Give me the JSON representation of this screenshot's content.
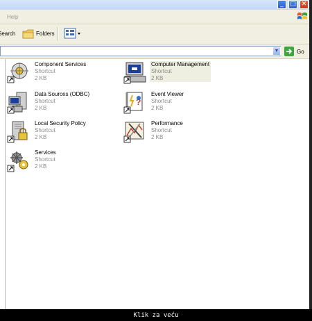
{
  "menubar": {
    "help_label": "Help"
  },
  "toolbar": {
    "search_label": "Search",
    "folders_label": "Folders"
  },
  "address": {
    "value": "",
    "go_label": "Go"
  },
  "items": [
    {
      "name": "Component Services",
      "type": "Shortcut",
      "size": "2 KB",
      "icon": "component-services-icon"
    },
    {
      "name": "Computer Management",
      "type": "Shortcut",
      "size": "2 KB",
      "icon": "computer-management-icon"
    },
    {
      "name": "Data Sources (ODBC)",
      "type": "Shortcut",
      "size": "2 KB",
      "icon": "data-sources-icon"
    },
    {
      "name": "Event Viewer",
      "type": "Shortcut",
      "size": "2 KB",
      "icon": "event-viewer-icon"
    },
    {
      "name": "Local Security Policy",
      "type": "Shortcut",
      "size": "2 KB",
      "icon": "local-security-policy-icon"
    },
    {
      "name": "Performance",
      "type": "Shortcut",
      "size": "2 KB",
      "icon": "performance-icon"
    },
    {
      "name": "Services",
      "type": "Shortcut",
      "size": "2 KB",
      "icon": "services-icon"
    }
  ],
  "footer": {
    "text": "Klik za veću"
  }
}
